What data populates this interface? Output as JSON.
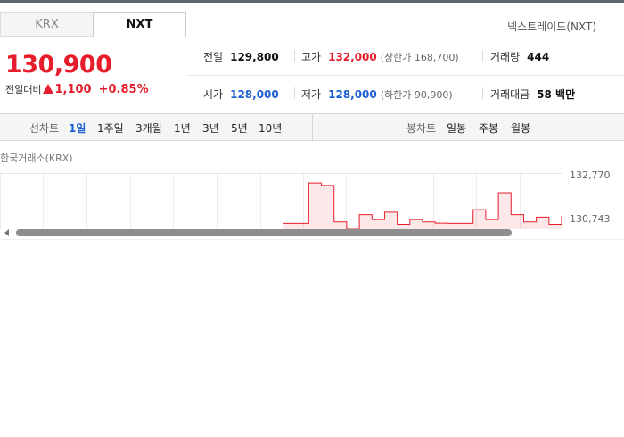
{
  "tabs": [
    {
      "label": "KRX",
      "selected": false
    },
    {
      "label": "NXT",
      "selected": true
    }
  ],
  "market_label": "넥스트레이드(NXT)",
  "price": {
    "current": "130,900",
    "change_label": "전일대비",
    "change_amount": "1,100",
    "change_percent": "+0.85%",
    "direction": "up"
  },
  "stats": {
    "prev_close": {
      "label": "전일",
      "value": "129,800"
    },
    "high": {
      "label": "고가",
      "value": "132,000",
      "sub": "(상한가 168,700)"
    },
    "volume": {
      "label": "거래량",
      "value": "444"
    },
    "open": {
      "label": "시가",
      "value": "128,000"
    },
    "low": {
      "label": "저가",
      "value": "128,000",
      "sub": "(하한가 90,900)"
    },
    "amount": {
      "label": "거래대금",
      "value": "58 백만"
    }
  },
  "toolbar": {
    "line_chart_label": "선차트",
    "periods": [
      "1일",
      "1주일",
      "3개월",
      "1년",
      "3년",
      "5년",
      "10년"
    ],
    "active_period": "1일",
    "candle_chart_label": "봉차트",
    "candle_periods": [
      "일봉",
      "주봉",
      "월봉"
    ]
  },
  "chart": {
    "title": "한국거래소(KRX)",
    "y_ticks": [
      "132,770",
      "130,743"
    ]
  },
  "chart_data": {
    "type": "line",
    "series": [
      {
        "values": [
          130743,
          130743,
          132400,
          132300,
          130800,
          130500,
          131100,
          130900,
          131200,
          130700,
          130900,
          130800,
          130750,
          130743,
          130743,
          131300,
          130900,
          132000,
          131100,
          130800,
          131000,
          130700,
          131050
        ]
      }
    ],
    "ylim": [
      130500,
      132770
    ],
    "grid": true
  },
  "colors": {
    "up": "#e61e2b",
    "down": "#1c5fd0",
    "active_period": "#1c5fd0"
  }
}
